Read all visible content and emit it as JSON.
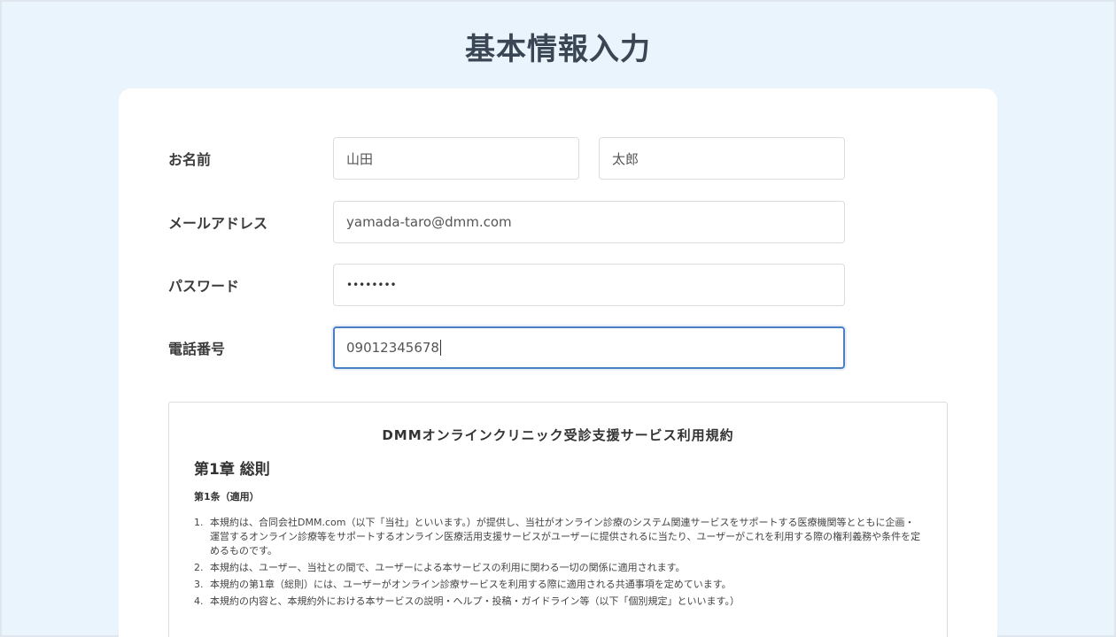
{
  "page_title": "基本情報入力",
  "form": {
    "name": {
      "label": "お名前",
      "last_name_value": "山田",
      "first_name_value": "太郎"
    },
    "email": {
      "label": "メールアドレス",
      "value": "yamada-taro@dmm.com"
    },
    "password": {
      "label": "パスワード",
      "masked_value": "••••••••"
    },
    "phone": {
      "label": "電話番号",
      "value": "09012345678"
    }
  },
  "terms": {
    "title": "DMMオンラインクリニック受診支援サービス利用規約",
    "chapter": "第1章 総則",
    "article": "第1条（適用）",
    "items": [
      {
        "num": "1.",
        "text": "本規約は、合同会社DMM.com（以下「当社」といいます。）が提供し、当社がオンライン診療のシステム関連サービスをサポートする医療機関等とともに企画・運営するオンライン診療等をサポートするオンライン医療活用支援サービスがユーザーに提供されるに当たり、ユーザーがこれを利用する際の権利義務や条件を定めるものです。"
      },
      {
        "num": "2.",
        "text": "本規約は、ユーザー、当社との間で、ユーザーによる本サービスの利用に関わる一切の関係に適用されます。"
      },
      {
        "num": "3.",
        "text": "本規約の第1章（総則）には、ユーザーがオンライン診療サービスを利用する際に適用される共通事項を定めています。"
      },
      {
        "num": "4.",
        "text": "本規約の内容と、本規約外における本サービスの説明・ヘルプ・投稿・ガイドライン等（以下「個別規定」といいます。）"
      }
    ]
  }
}
